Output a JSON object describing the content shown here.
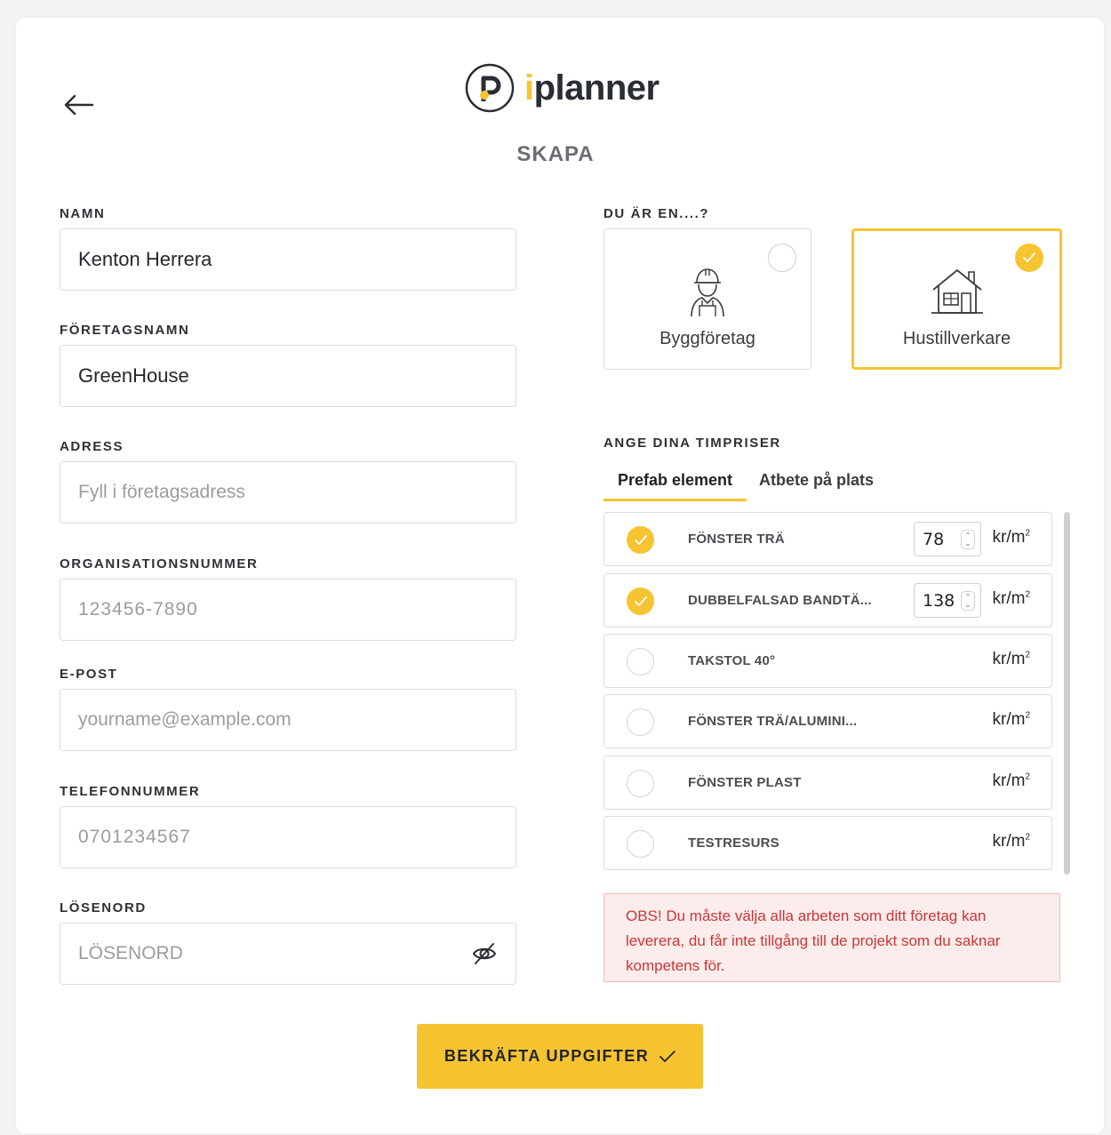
{
  "brand": {
    "name_prefix": "i",
    "name_rest": "planner",
    "accent": "#f6c431"
  },
  "page": {
    "title": "SKAPA"
  },
  "form": {
    "name": {
      "label": "NAMN",
      "value": "Kenton Herrera"
    },
    "company": {
      "label": "FÖRETAGSNAMN",
      "value": "GreenHouse"
    },
    "address": {
      "label": "ADRESS",
      "placeholder": "Fyll i företagsadress"
    },
    "orgnr": {
      "label": "ORGANISATIONSNUMMER",
      "placeholder": "123456-7890"
    },
    "email": {
      "label": "E-POST",
      "placeholder": "yourname@example.com"
    },
    "phone": {
      "label": "TELEFONNUMMER",
      "placeholder": "0701234567"
    },
    "password": {
      "label": "LÖSENORD",
      "placeholder": "LÖSENORD"
    }
  },
  "role": {
    "label": "DU ÄR EN....?",
    "options": [
      {
        "label": "Byggföretag",
        "icon": "construction-worker-icon",
        "selected": false
      },
      {
        "label": "Hustillverkare",
        "icon": "house-icon",
        "selected": true
      }
    ]
  },
  "pricing": {
    "label": "ANGE DINA TIMPRISER",
    "tabs": [
      {
        "label": "Prefab element",
        "active": true
      },
      {
        "label": "Atbete på plats",
        "active": false
      }
    ],
    "unit": "kr/m",
    "unit_sup": "2",
    "items": [
      {
        "label": "FÖNSTER TRÄ",
        "checked": true,
        "value": "78"
      },
      {
        "label": "DUBBELFALSAD BANDTÄ...",
        "checked": true,
        "value": "138"
      },
      {
        "label": "TAKSTOL 40°",
        "checked": false,
        "value": ""
      },
      {
        "label": "FÖNSTER TRÄ/ALUMINI...",
        "checked": false,
        "value": ""
      },
      {
        "label": "FÖNSTER PLAST",
        "checked": false,
        "value": ""
      },
      {
        "label": "TESTRESURS",
        "checked": false,
        "value": ""
      }
    ]
  },
  "notice": {
    "text": "OBS! Du måste välja alla arbeten som ditt företag kan leverera, du får inte tillgång till de projekt som du saknar kompetens för."
  },
  "confirm": {
    "label": "BEKRÄFTA UPPGIFTER"
  }
}
